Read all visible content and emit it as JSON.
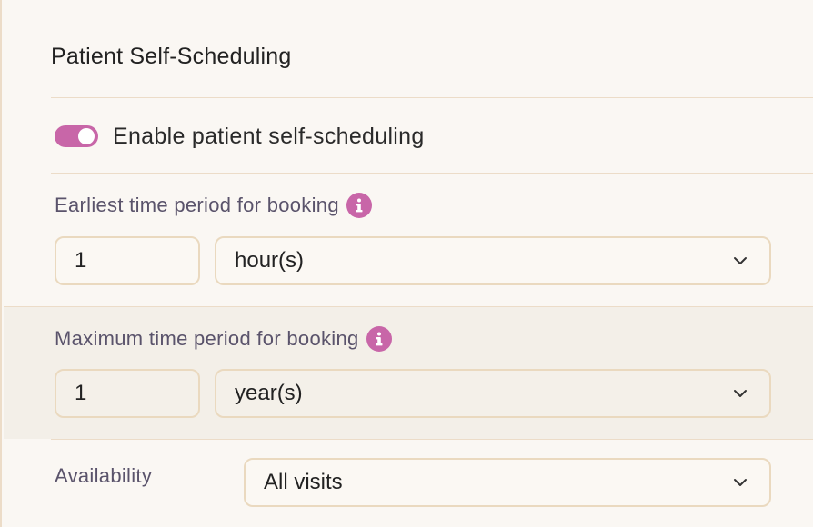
{
  "section": {
    "title": "Patient Self-Scheduling"
  },
  "toggle": {
    "label": "Enable patient self-scheduling",
    "enabled": true,
    "color": "#c866a8"
  },
  "earliest": {
    "label": "Earliest time period for booking",
    "info_icon": "info-icon",
    "amount": "1",
    "unit": "hour(s)"
  },
  "maximum": {
    "label": "Maximum time period for booking",
    "info_icon": "info-icon",
    "amount": "1",
    "unit": "year(s)"
  },
  "availability": {
    "label": "Availability",
    "value": "All visits"
  },
  "icons": {
    "dropdown": "chevron-down-icon"
  }
}
